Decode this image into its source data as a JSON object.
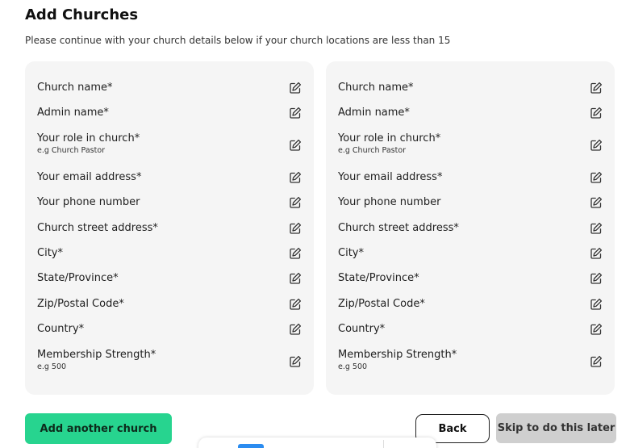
{
  "header": {
    "title": "Add Churches",
    "subtitle": "Please continue with your church details below if your church locations are less than 15"
  },
  "cards": [
    {
      "fields": [
        {
          "label": "Church name*"
        },
        {
          "label": "Admin name*"
        },
        {
          "label": "Your role in church*",
          "hint": "e.g Church Pastor"
        },
        {
          "label": "Your email address*"
        },
        {
          "label": "Your phone number"
        },
        {
          "label": "Church street address*"
        },
        {
          "label": "City*"
        },
        {
          "label": "State/Province*"
        },
        {
          "label": "Zip/Postal Code*"
        },
        {
          "label": "Country*"
        },
        {
          "label": "Membership Strength*",
          "hint": "e.g 500"
        }
      ]
    },
    {
      "fields": [
        {
          "label": "Church name*"
        },
        {
          "label": "Admin name*"
        },
        {
          "label": "Your role in church*",
          "hint": "e.g Church Pastor"
        },
        {
          "label": "Your email address*"
        },
        {
          "label": "Your phone number"
        },
        {
          "label": "Church street address*"
        },
        {
          "label": "City*"
        },
        {
          "label": "State/Province*"
        },
        {
          "label": "Zip/Postal Code*"
        },
        {
          "label": "Country*"
        },
        {
          "label": "Membership Strength*",
          "hint": "e.g 500"
        }
      ]
    }
  ],
  "icons": {
    "field_action": "edit-icon"
  },
  "actions": {
    "add_another": "Add another church",
    "back": "Back",
    "skip": "Skip to do this later"
  },
  "colors": {
    "primary_button": "#27d48f",
    "skip_button": "#cfcfcf",
    "card_background": "#f5f5f5",
    "popover_accent": "#2b8cf0"
  }
}
